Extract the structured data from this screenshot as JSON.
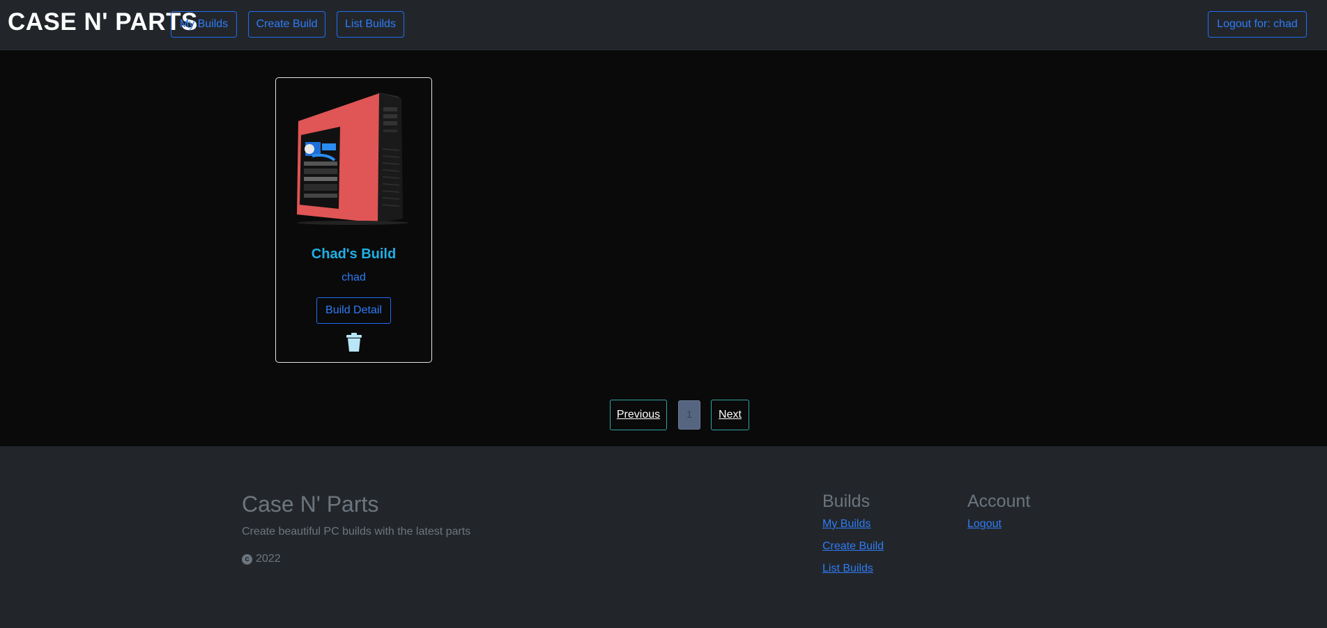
{
  "header": {
    "brand": "CASE N' PARTS",
    "nav": {
      "my_builds": "My Builds",
      "create_build": "Create Build",
      "list_builds": "List Builds"
    },
    "logout": "Logout for: chad"
  },
  "build_card": {
    "title": "Chad's Build",
    "user": "chad",
    "detail_button": "Build Detail"
  },
  "pagination": {
    "previous": "Previous",
    "current_page": "1",
    "next": "Next"
  },
  "footer": {
    "brand": "Case N' Parts",
    "tagline": "Create beautiful PC builds with the latest parts",
    "copyright_year": "2022",
    "builds_title": "Builds",
    "builds_links": {
      "my_builds": "My Builds",
      "create_build": "Create Build",
      "list_builds": "List Builds"
    },
    "account_title": "Account",
    "account_links": {
      "logout": "Logout"
    }
  },
  "colors": {
    "header_bg": "#22262b",
    "main_bg": "#0a0a0a",
    "link_blue": "#2f7cf6",
    "title_cyan": "#1fb0e6",
    "pagination_border": "#2ea7a1",
    "case_red": "#e05555"
  },
  "icons": {
    "delete": "trash-icon",
    "copyright": "copyright-icon"
  }
}
